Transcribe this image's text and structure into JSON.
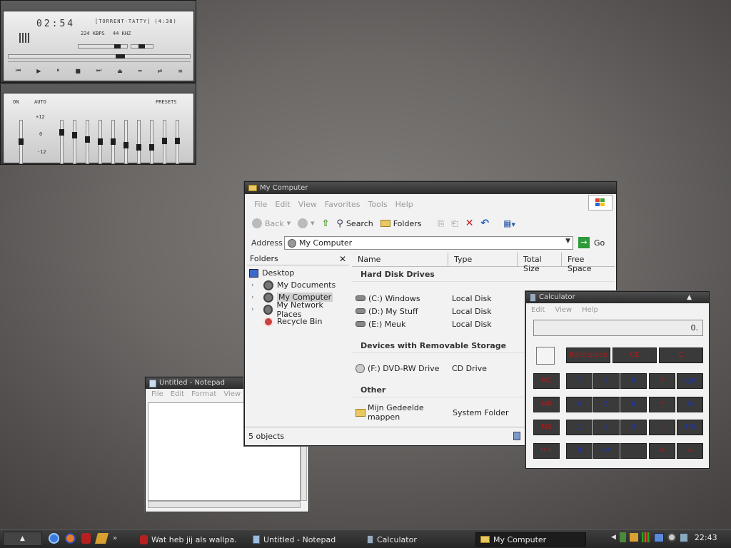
{
  "winamp": {
    "time": "02:54",
    "track": "[TORRENT-TATTY] (4:38)",
    "bitrate": "224 KBPS",
    "khz": "44 KHZ",
    "eq_on": "ON",
    "eq_auto": "AUTO",
    "eq_presets": "PRESETS",
    "eq_plus": "+12",
    "eq_zero": "0",
    "eq_minus": "-12"
  },
  "explorer": {
    "title": "My Computer",
    "menu": [
      "File",
      "Edit",
      "View",
      "Favorites",
      "Tools",
      "Help"
    ],
    "back": "Back",
    "search": "Search",
    "folders": "Folders",
    "address_label": "Address",
    "address_value": "My Computer",
    "go": "Go",
    "folders_pane_title": "Folders",
    "tree": [
      "Desktop",
      "My Documents",
      "My Computer",
      "My Network Places",
      "Recycle Bin"
    ],
    "columns": [
      "Name",
      "Type",
      "Total Size",
      "Free Space"
    ],
    "groups": [
      "Hard Disk Drives",
      "Devices with Removable Storage",
      "Other"
    ],
    "hdd": [
      {
        "name": "(C:) Windows",
        "type": "Local Disk"
      },
      {
        "name": "(D:) My Stuff",
        "type": "Local Disk"
      },
      {
        "name": "(E:) Meuk",
        "type": "Local Disk"
      }
    ],
    "removable": [
      {
        "name": "(F:) DVD-RW Drive",
        "type": "CD Drive"
      }
    ],
    "other": [
      {
        "name": "Mijn Gedeelde mappen",
        "type": "System Folder"
      }
    ],
    "status": "5 objects"
  },
  "notepad": {
    "title": "Untitled - Notepad",
    "menu": [
      "File",
      "Edit",
      "Format",
      "View"
    ]
  },
  "calculator": {
    "title": "Calculator",
    "menu": [
      "Edit",
      "View",
      "Help"
    ],
    "display": "0.",
    "top_buttons": [
      "Backspace",
      "CE",
      "C"
    ],
    "rows": [
      [
        "MC",
        "7",
        "8",
        "9",
        "/",
        "sqrt"
      ],
      [
        "MR",
        "4",
        "5",
        "6",
        "*",
        "%"
      ],
      [
        "MS",
        "1",
        "2",
        "3",
        "-",
        "1/x"
      ],
      [
        "M+",
        "0",
        "+/-",
        ".",
        "+",
        "="
      ]
    ]
  },
  "taskbar": {
    "tasks": [
      "Wat heb jij als wallpa...",
      "Untitled - Notepad",
      "Calculator",
      "My Computer"
    ],
    "clock": "22:43"
  }
}
